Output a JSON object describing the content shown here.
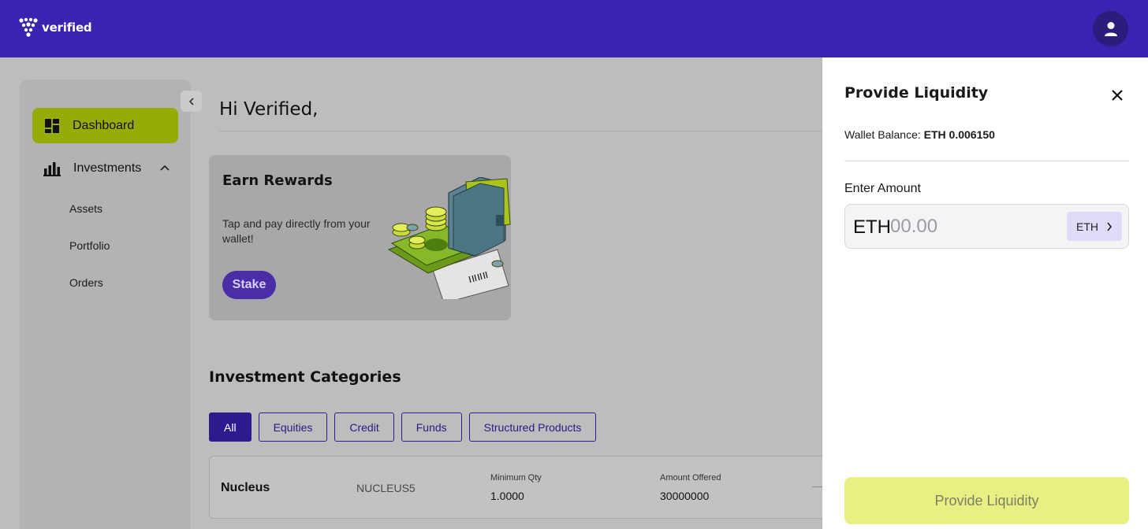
{
  "header": {
    "brand": "verified",
    "avatar_icon": "user-icon"
  },
  "sidebar": {
    "dashboard_label": "Dashboard",
    "investments_label": "Investments",
    "sub_items": [
      "Assets",
      "Portfolio",
      "Orders"
    ]
  },
  "main": {
    "greeting": "Hi Verified,",
    "rewards": {
      "title": "Earn Rewards",
      "description": "Tap and pay directly from your wallet!",
      "button": "Stake"
    },
    "categories": {
      "title": "Investment Categories",
      "filters": [
        "All",
        "Equities",
        "Credit",
        "Funds",
        "Structured Products"
      ],
      "active_filter": "All"
    },
    "row": {
      "name": "Nucleus",
      "code": "NUCLEUS5",
      "min_qty_label": "Minimum Qty",
      "min_qty_value": "1.0000",
      "amount_label": "Amount Offered",
      "amount_value": "30000000"
    }
  },
  "drawer": {
    "title": "Provide Liquidity",
    "balance_label": "Wallet Balance:",
    "balance_value": "ETH 0.006150",
    "enter_label": "Enter Amount",
    "prefix": "ETH",
    "placeholder": "00.00",
    "currency": "ETH",
    "submit_label": "Provide Liquidity"
  },
  "colors": {
    "brand": "#3b22b1",
    "accent": "#96ab05",
    "submit_bg": "#e8f083"
  }
}
